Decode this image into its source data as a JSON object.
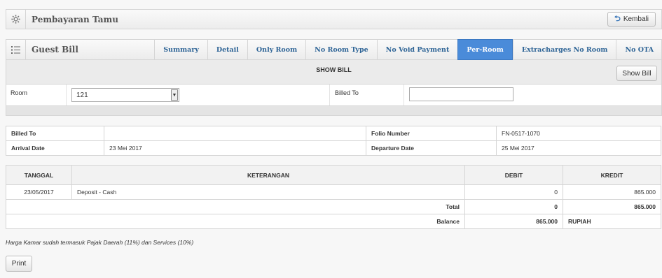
{
  "header": {
    "title": "Pembayaran Tamu",
    "back_label": "Kembali",
    "icon": "gear-icon"
  },
  "guest_bill": {
    "title": "Guest Bill",
    "icon": "list-icon",
    "tabs": [
      {
        "label": "Summary"
      },
      {
        "label": "Detail"
      },
      {
        "label": "Only Room"
      },
      {
        "label": "No Room Type"
      },
      {
        "label": "No Void Payment"
      },
      {
        "label": "Per-Room"
      },
      {
        "label": "Extracharges No Room"
      },
      {
        "label": "No OTA"
      }
    ],
    "active_tab": "Per-Room"
  },
  "show_bill": {
    "title": "SHOW BILL",
    "button_label": "Show Bill",
    "room_label": "Room",
    "room_value": "121",
    "billed_to_label": "Billed To",
    "billed_to_value": ""
  },
  "info": {
    "billed_to_label": "Billed To",
    "billed_to_value": "",
    "folio_label": "Folio Number",
    "folio_value": "FN-0517-1070",
    "arrival_label": "Arrival Date",
    "arrival_value": "23 Mei 2017",
    "departure_label": "Departure Date",
    "departure_value": "25 Mei 2017"
  },
  "bill": {
    "headers": [
      "TANGGAL",
      "KETERANGAN",
      "DEBIT",
      "KREDIT"
    ],
    "rows": [
      {
        "tanggal": "23/05/2017",
        "keterangan": "Deposit - Cash",
        "debit": "0",
        "kredit": "865.000"
      }
    ],
    "total_label": "Total",
    "total_debit": "0",
    "total_kredit": "865.000",
    "balance_label": "Balance",
    "balance_value": "865.000",
    "currency": "RUPIAH"
  },
  "note": "Harga Kamar sudah termasuk Pajak Daerah (11%) dan Services (10%)",
  "print_label": "Print",
  "colors": {
    "active_tab": "#4a8bd9",
    "tab_text": "#2e6496"
  }
}
